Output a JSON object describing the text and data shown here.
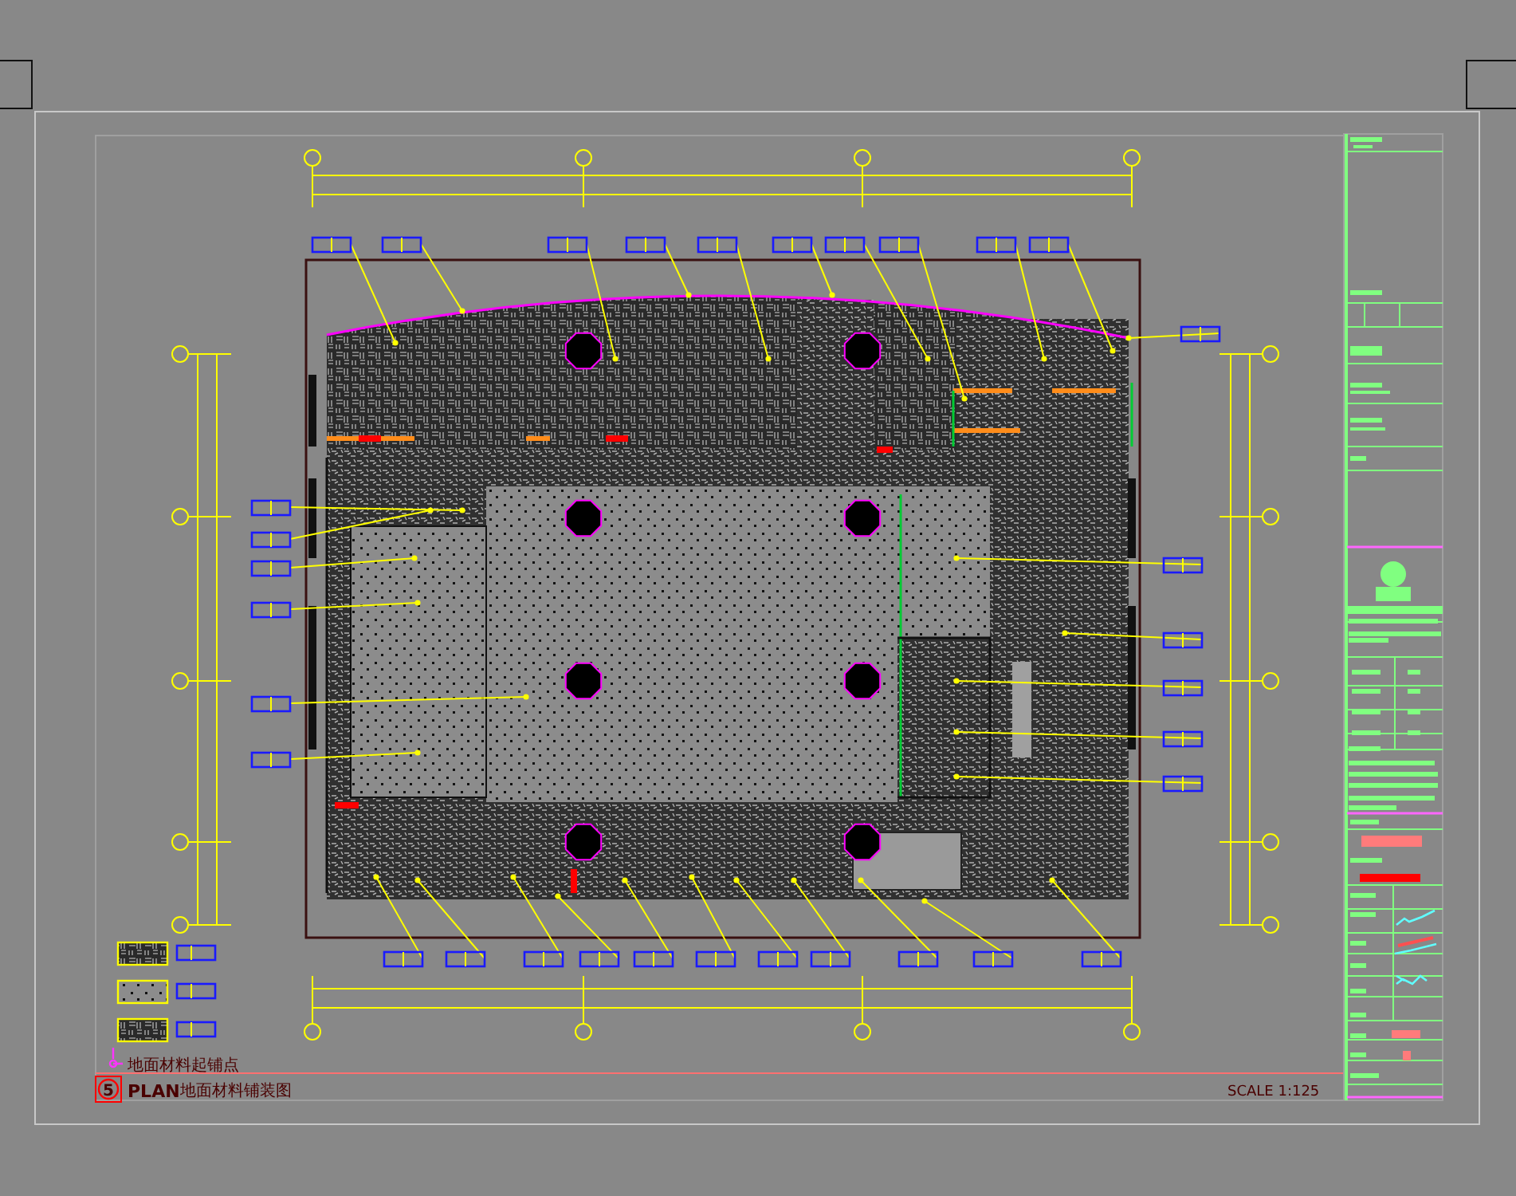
{
  "canvas": {
    "start_point_note": "地面材料起铺点",
    "title": {
      "number": "5",
      "label": "PLAN",
      "name": "地面材料铺装图"
    },
    "scale": "SCALE 1:125"
  }
}
